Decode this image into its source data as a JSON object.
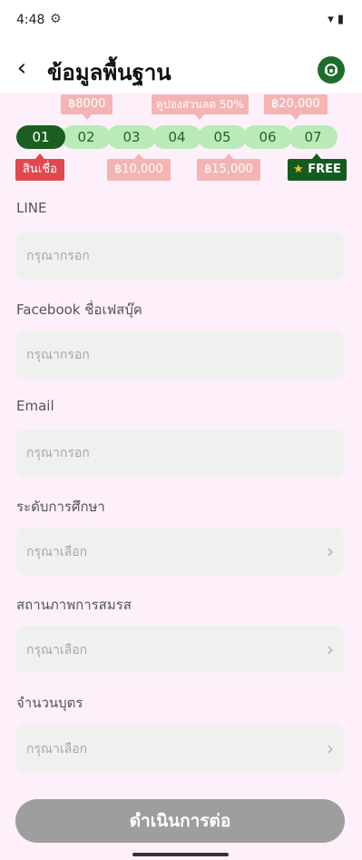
{
  "status": {
    "time": "4:48",
    "gear": "⚙",
    "right": "▾ ▮"
  },
  "header": {
    "back": "‹",
    "title": "ข้อมูลพื้นฐาน"
  },
  "steps": [
    "01",
    "02",
    "03",
    "04",
    "05",
    "06",
    "07"
  ],
  "badges_top": [
    "฿8000",
    "คูปองส่วนลด 50%",
    "฿20,000"
  ],
  "badges_bottom": [
    "สินเชื่อ",
    "฿10,000",
    "฿15,000",
    "FREE"
  ],
  "star": "★",
  "fields": [
    {
      "label": "LINE",
      "placeholder": "กรุณากรอก"
    },
    {
      "label": "Facebook ชื่อเฟสบุ๊ค",
      "placeholder": "กรุณากรอก"
    },
    {
      "label": "Email",
      "placeholder": "กรุณากรอก"
    }
  ],
  "selects": [
    {
      "label": "ระดับการศึกษา",
      "placeholder": "กรุณาเลือก"
    },
    {
      "label": "สถานภาพการสมรส",
      "placeholder": "กรุณาเลือก"
    },
    {
      "label": "จำนวนบุตร",
      "placeholder": "กรุณาเลือก"
    }
  ],
  "chevron": "›",
  "continue_label": "ดำเนินการต่อ",
  "colors": {
    "primary": "#1b5e20",
    "step_inactive": "#b9eab8",
    "badge": "#f4b4b4",
    "badge_red": "#e0484d",
    "background": "#fdf0fa"
  }
}
